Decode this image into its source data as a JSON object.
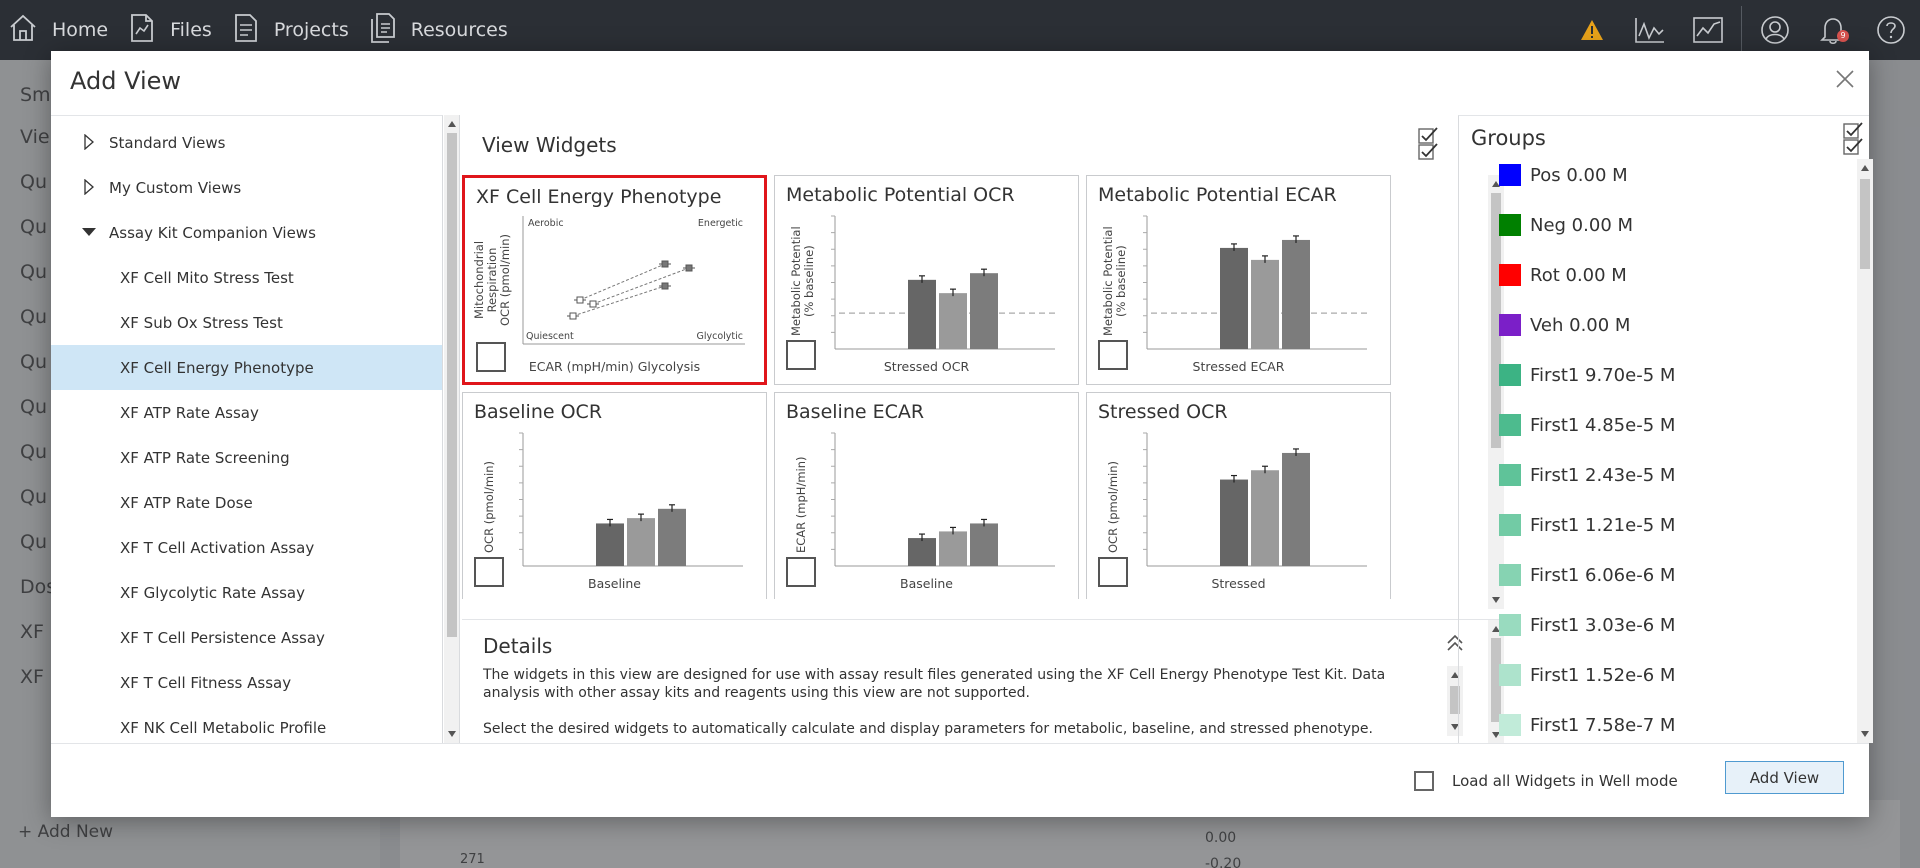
{
  "nav": {
    "items": [
      {
        "label": "Home",
        "icon": "home-icon"
      },
      {
        "label": "Files",
        "icon": "files-icon"
      },
      {
        "label": "Projects",
        "icon": "projects-icon"
      },
      {
        "label": "Resources",
        "icon": "resources-icon"
      }
    ],
    "notification_count": "9"
  },
  "background": {
    "sidebar_partial_text": [
      "Smo",
      "Vie",
      "Qu",
      "Qu",
      "Qu",
      "Qu",
      "Qu",
      "Qu",
      "Qu",
      "Qu",
      "Qu",
      "Dos",
      "XF",
      "XF"
    ],
    "add_new": "+ Add New",
    "y_tick": "271",
    "axis_value_1": "0.00",
    "axis_value_2": "-0.20"
  },
  "modal": {
    "title": "Add View",
    "tree": {
      "items": [
        {
          "label": "Standard Views",
          "type": "parent",
          "expanded": false
        },
        {
          "label": "My Custom Views",
          "type": "parent",
          "expanded": false
        },
        {
          "label": "Assay Kit Companion Views",
          "type": "parent",
          "expanded": true
        },
        {
          "label": "XF Cell Mito Stress Test",
          "type": "child"
        },
        {
          "label": "XF Sub Ox Stress Test",
          "type": "child"
        },
        {
          "label": "XF Cell Energy Phenotype",
          "type": "child",
          "selected": true
        },
        {
          "label": "XF ATP Rate Assay",
          "type": "child"
        },
        {
          "label": "XF ATP Rate Screening",
          "type": "child"
        },
        {
          "label": "XF ATP Rate Dose",
          "type": "child"
        },
        {
          "label": "XF T Cell Activation Assay",
          "type": "child"
        },
        {
          "label": "XF Glycolytic Rate Assay",
          "type": "child"
        },
        {
          "label": "XF T Cell Persistence Assay",
          "type": "child"
        },
        {
          "label": "XF T Cell Fitness Assay",
          "type": "child"
        },
        {
          "label": "XF NK Cell Metabolic Profile",
          "type": "child"
        }
      ]
    },
    "widgets_header": "View Widgets",
    "widgets": [
      {
        "title": "XF Cell Energy Phenotype",
        "xlabel": "ECAR (mpH/min) Glycolysis",
        "ylabel": [
          "Mitochondrial",
          "Respiration",
          "OCR (pmol/min)"
        ],
        "quadrants": {
          "top_left": "Aerobic",
          "top_right": "Energetic",
          "bottom_left": "Quiescent",
          "bottom_right": "Glycolytic"
        },
        "highlighted": true
      },
      {
        "title": "Metabolic Potential OCR",
        "xlabel": "Stressed OCR",
        "ylabel": [
          "Metabolic Potential",
          "(% baseline)"
        ],
        "bars": [
          0.52,
          0.42,
          0.57
        ],
        "baseline": 0.27
      },
      {
        "title": "Metabolic Potential ECAR",
        "xlabel": "Stressed ECAR",
        "ylabel": [
          "Metabolic Potential",
          "(% baseline)"
        ],
        "bars": [
          0.76,
          0.67,
          0.82
        ],
        "baseline": 0.27
      },
      {
        "title": "Baseline OCR",
        "xlabel": "Baseline",
        "ylabel": [
          "OCR (pmol/min)"
        ],
        "bars": [
          0.32,
          0.36,
          0.43
        ]
      },
      {
        "title": "Baseline ECAR",
        "xlabel": "Baseline",
        "ylabel": [
          "ECAR (mpH/min)"
        ],
        "bars": [
          0.21,
          0.26,
          0.32
        ]
      },
      {
        "title": "Stressed OCR",
        "xlabel": "Stressed",
        "ylabel": [
          "OCR (pmol/min)"
        ],
        "bars": [
          0.65,
          0.72,
          0.85
        ]
      }
    ],
    "details": {
      "title": "Details",
      "paragraph1": "The widgets in this view are designed for use with assay result files generated using the XF Cell Energy Phenotype Test Kit. Data analysis with other assay kits and reagents using this view are not supported.",
      "paragraph2": "Select the desired widgets to automatically calculate and display parameters for metabolic, baseline, and stressed phenotype."
    },
    "groups": {
      "title": "Groups",
      "items": [
        {
          "label": "Pos 0.00 M",
          "color": "#0000ff"
        },
        {
          "label": "Neg 0.00 M",
          "color": "#008000"
        },
        {
          "label": "Rot 0.00 M",
          "color": "#ff0000"
        },
        {
          "label": "Veh 0.00 M",
          "color": "#7b1fc8"
        },
        {
          "label": "First1 9.70e-5 M",
          "color": "#3cb384"
        },
        {
          "label": "First1 4.85e-5 M",
          "color": "#4dbb8e"
        },
        {
          "label": "First1 2.43e-5 M",
          "color": "#5fc399"
        },
        {
          "label": "First1 1.21e-5 M",
          "color": "#72cba5"
        },
        {
          "label": "First1 6.06e-6 M",
          "color": "#86d3b2"
        },
        {
          "label": "First1 3.03e-6 M",
          "color": "#99dbbf"
        },
        {
          "label": "First1 1.52e-6 M",
          "color": "#ade3cc"
        },
        {
          "label": "First1 7.58e-7 M",
          "color": "#c1ebd9"
        }
      ]
    },
    "footer": {
      "well_mode_label": "Load all Widgets in Well mode",
      "add_button": "Add View"
    }
  }
}
